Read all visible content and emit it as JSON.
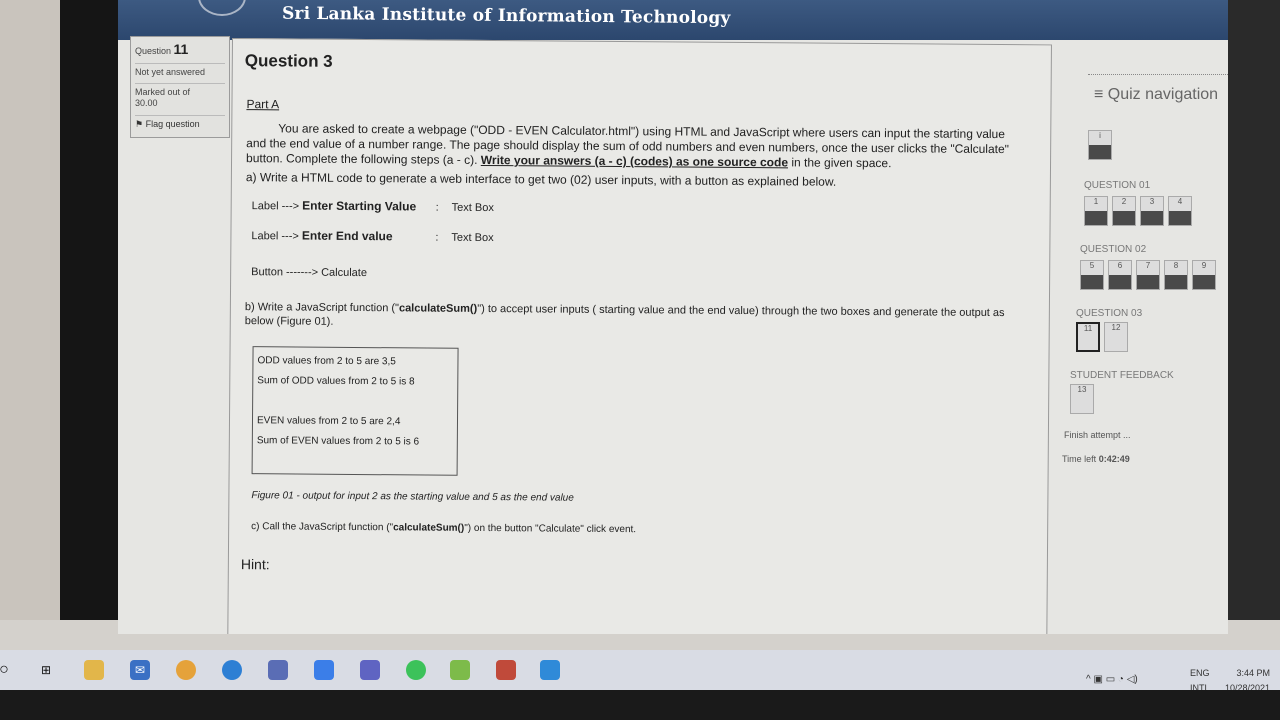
{
  "site": {
    "title": "Sri Lanka Institute of Information Technology"
  },
  "question_info": {
    "label": "Question",
    "number": "11",
    "state": "Not yet answered",
    "marked_label": "Marked out of",
    "marked_value": "30.00",
    "flag_label": "Flag question"
  },
  "question": {
    "title": "Question 3",
    "part": "Part A",
    "intro_before": "You are asked to create a webpage (\"ODD - EVEN Calculator.html\") using HTML and JavaScript where users can input the starting value and the end value of a number range. The page should display the sum of odd numbers and even numbers, once the user clicks the \"Calculate\" button. Complete the following steps (a - c). ",
    "intro_emphasis": "Write your answers (a - c) (codes) as one source code",
    "intro_after": " in the given space.",
    "step_a": "a)  Write a HTML code to generate a web interface to get two  (02) user inputs, with a  button as explained below.",
    "fields": [
      {
        "prefix": "Label  --->",
        "name": "Enter Starting Value",
        "colon": ":",
        "type": "Text Box"
      },
      {
        "prefix": "Label  --->",
        "name": "Enter End value",
        "colon": ":",
        "type": "Text Box"
      }
    ],
    "button_line": "Button -------> Calculate",
    "step_b_before": "b)  Write a JavaScript function (\"",
    "step_b_func": "calculateSum()",
    "step_b_after": "\") to accept user inputs ( starting value and the end value)  through the two boxes and generate the output as below (Figure 01).",
    "output_lines": [
      "ODD values from 2 to 5 are 3,5",
      "Sum of ODD values from 2 to 5 is 8",
      "EVEN values from 2 to 5 are 2,4",
      "Sum of EVEN values from 2 to 5 is 6"
    ],
    "figure_caption": "Figure 01 - output for input 2 as the starting value and 5 as the end value",
    "step_c_before": "c)  Call the JavaScript function (\"",
    "step_c_func": "calculateSum()",
    "step_c_after": "\") on the button  \"Calculate\" click event.",
    "hint": "Hint:"
  },
  "quiz_nav": {
    "title": "≡ Quiz navigation",
    "first_button": "i",
    "sections": [
      {
        "label": "QUESTION 01",
        "items": [
          "1",
          "2",
          "3",
          "4"
        ]
      },
      {
        "label": "QUESTION 02",
        "items": [
          "5",
          "6",
          "7",
          "8",
          "9"
        ]
      },
      {
        "label": "QUESTION 03",
        "items": [
          "11",
          "12"
        ]
      },
      {
        "label": "STUDENT FEEDBACK",
        "items": [
          "13"
        ]
      }
    ],
    "finish_attempt": "Finish attempt ...",
    "time_left_label": "Time left",
    "time_left_value": "0:42:49"
  },
  "taskbar": {
    "lang": "ENG",
    "layout": "INTL",
    "time": "3:44 PM",
    "date": "10/28/2021",
    "icons": [
      "search-icon",
      "task-view-icon",
      "file-explorer-icon",
      "mail-icon",
      "chrome-icon",
      "edge-icon",
      "app-icon",
      "zoom-icon",
      "teams-icon",
      "whatsapp-icon",
      "paint-icon",
      "calculator-icon",
      "photos-icon"
    ]
  }
}
